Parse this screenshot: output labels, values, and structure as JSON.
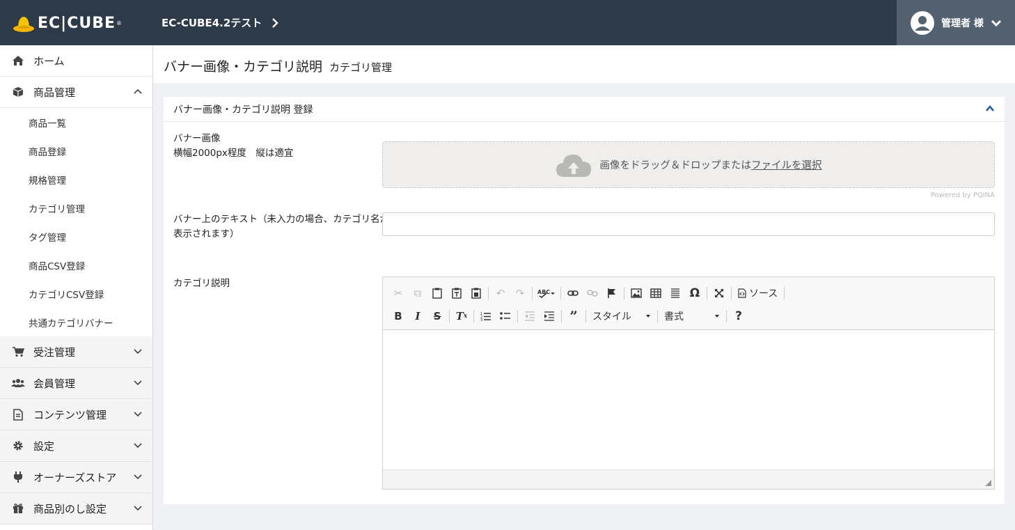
{
  "header": {
    "logo_text": "EC|CUBE",
    "shop_name": "EC-CUBE4.2テスト",
    "user_name": "管理者 様"
  },
  "sidebar": {
    "items": [
      {
        "label": "ホーム",
        "icon": "home-icon"
      },
      {
        "label": "商品管理",
        "icon": "box-icon",
        "expanded": true,
        "children": [
          "商品一覧",
          "商品登録",
          "規格管理",
          "カテゴリ管理",
          "タグ管理",
          "商品CSV登録",
          "カテゴリCSV登録",
          "共通カテゴリバナー"
        ]
      },
      {
        "label": "受注管理",
        "icon": "cart-icon"
      },
      {
        "label": "会員管理",
        "icon": "users-icon"
      },
      {
        "label": "コンテンツ管理",
        "icon": "file-icon"
      },
      {
        "label": "設定",
        "icon": "gear-icon"
      },
      {
        "label": "オーナーズストア",
        "icon": "plug-icon"
      },
      {
        "label": "商品別のし設定",
        "icon": "gift-icon"
      }
    ]
  },
  "main": {
    "title": "バナー画像・カテゴリ説明",
    "subtitle": "カテゴリ管理",
    "card_title": "バナー画像・カテゴリ説明 登録",
    "banner_label_line1": "バナー画像",
    "banner_label_line2": "横幅2000px程度　縦は適宜",
    "dropzone_text": "画像をドラッグ＆ドロップまたは",
    "dropzone_link": "ファイルを選択",
    "powered_by": "Powered by PQINA",
    "banner_text_label_line1": "バナー上のテキスト（未入力の場合、カテゴリ名が",
    "banner_text_label_line2": "表示されます）",
    "banner_text_value": "",
    "description_label": "カテゴリ説明",
    "editor": {
      "source_label": "ソース",
      "style_label": "スタイル",
      "format_label": "書式",
      "help_label": "?"
    }
  },
  "colors": {
    "header_bg": "#2d3a4a",
    "user_box_bg": "#546170",
    "accent": "#2a5f9e"
  }
}
